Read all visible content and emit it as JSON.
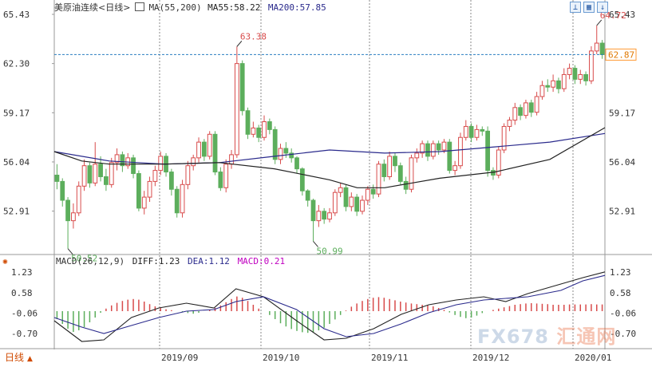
{
  "main_panel": {
    "title": "美原油连续<日线>",
    "ma_label": "MA(55,200)",
    "ma55_text": "MA55:58.22",
    "ma200_text": "MA200:57.85",
    "current_price": "62.87",
    "annotations": {
      "high1": "63.38",
      "low1": "50.52",
      "low2": "50.99",
      "high2": "64.72"
    }
  },
  "macd_panel": {
    "label": "MACD(26,12,9)",
    "diff_text": "DIFF:1.23",
    "dea_text": "DEA:1.12",
    "macd_text": "MACD:0.21"
  },
  "bottom": {
    "tab_label": "日线",
    "watermark_a": "FX678",
    "watermark_b": "汇通网"
  },
  "colors": {
    "up": "#d84b4b",
    "down": "#5cae5c",
    "ma_blue": "#2a2a8c",
    "ma_black": "#222222",
    "grid": "#888888",
    "price_line": "#2a7fc0",
    "price_tag": "#ff9a33",
    "macd_pos": "#d84b4b",
    "macd_neg": "#5cae5c",
    "dea_line": "#2a2a8c"
  },
  "chart_data": [
    {
      "type": "candlestick",
      "y_ticks_left": [
        "65.43",
        "62.30",
        "59.17",
        "56.04",
        "52.91"
      ],
      "y_ticks_right": [
        "65.43",
        "62.87",
        "59.17",
        "56.04",
        "52.91"
      ],
      "x_labels": [
        "2019/09",
        "2019/10",
        "2019/11",
        "2019/12",
        "2020/01"
      ],
      "ylim": [
        50.2,
        65.43
      ],
      "last_price": 62.87,
      "candles": [
        [
          55.2,
          54.8,
          55.9,
          54.3
        ],
        [
          54.8,
          53.6,
          55.0,
          53.2
        ],
        [
          53.6,
          52.3,
          53.8,
          50.52
        ],
        [
          52.3,
          52.8,
          53.4,
          51.8
        ],
        [
          52.8,
          54.5,
          54.8,
          52.6
        ],
        [
          54.5,
          55.8,
          56.2,
          54.2
        ],
        [
          55.8,
          54.7,
          56.0,
          54.4
        ],
        [
          54.7,
          55.9,
          57.3,
          54.5
        ],
        [
          55.9,
          55.1,
          56.4,
          54.8
        ],
        [
          55.1,
          54.6,
          55.6,
          54.2
        ],
        [
          54.6,
          56.0,
          56.3,
          54.4
        ],
        [
          56.0,
          56.5,
          56.9,
          55.5
        ],
        [
          56.5,
          55.8,
          56.7,
          55.4
        ],
        [
          55.8,
          56.3,
          56.6,
          55.6
        ],
        [
          56.3,
          55.3,
          56.5,
          55.0
        ],
        [
          55.3,
          53.1,
          55.5,
          52.9
        ],
        [
          53.1,
          53.8,
          54.2,
          52.7
        ],
        [
          53.8,
          54.8,
          55.1,
          53.5
        ],
        [
          54.8,
          55.5,
          55.8,
          54.5
        ],
        [
          55.5,
          56.4,
          56.7,
          55.2
        ],
        [
          56.4,
          55.4,
          56.6,
          55.1
        ],
        [
          55.4,
          54.3,
          55.6,
          53.9
        ],
        [
          54.3,
          52.8,
          54.5,
          52.5
        ],
        [
          52.8,
          54.6,
          54.9,
          52.5
        ],
        [
          54.6,
          55.8,
          56.1,
          54.3
        ],
        [
          55.8,
          56.3,
          56.5,
          55.5
        ],
        [
          56.3,
          57.3,
          57.6,
          56.0
        ],
        [
          57.3,
          56.4,
          57.5,
          56.1
        ],
        [
          56.4,
          57.8,
          58.0,
          56.2
        ],
        [
          57.8,
          55.4,
          58.0,
          55.2
        ],
        [
          55.4,
          54.4,
          55.7,
          54.2
        ],
        [
          54.4,
          55.9,
          56.2,
          54.1
        ],
        [
          55.9,
          56.5,
          56.8,
          55.6
        ],
        [
          56.5,
          62.3,
          63.38,
          56.3
        ],
        [
          62.3,
          59.3,
          62.5,
          59.0
        ],
        [
          59.3,
          57.8,
          59.5,
          57.5
        ],
        [
          57.8,
          58.2,
          58.6,
          57.6
        ],
        [
          58.2,
          57.6,
          58.4,
          57.3
        ],
        [
          57.6,
          58.6,
          59.0,
          57.4
        ],
        [
          58.6,
          58.1,
          58.8,
          57.8
        ],
        [
          58.1,
          56.2,
          58.3,
          55.9
        ],
        [
          56.2,
          56.9,
          57.2,
          55.9
        ],
        [
          56.9,
          56.6,
          57.3,
          56.3
        ],
        [
          56.6,
          56.3,
          56.9,
          56.0
        ],
        [
          56.3,
          55.6,
          56.4,
          55.3
        ],
        [
          55.6,
          54.2,
          55.7,
          53.9
        ],
        [
          54.2,
          53.6,
          54.3,
          53.2
        ],
        [
          53.6,
          52.3,
          53.7,
          50.99
        ],
        [
          52.3,
          52.9,
          53.3,
          51.9
        ],
        [
          52.9,
          52.4,
          53.1,
          52.1
        ],
        [
          52.4,
          52.8,
          53.1,
          52.2
        ],
        [
          52.8,
          54.1,
          54.3,
          52.6
        ],
        [
          54.1,
          54.4,
          54.7,
          53.8
        ],
        [
          54.4,
          53.2,
          54.6,
          52.9
        ],
        [
          53.2,
          53.8,
          54.1,
          52.9
        ],
        [
          53.8,
          52.9,
          54.0,
          52.6
        ],
        [
          52.9,
          53.6,
          53.9,
          52.7
        ],
        [
          53.6,
          54.3,
          54.5,
          53.3
        ],
        [
          54.3,
          54.0,
          54.6,
          53.7
        ],
        [
          54.0,
          55.9,
          56.1,
          53.8
        ],
        [
          55.9,
          55.1,
          56.2,
          54.8
        ],
        [
          55.1,
          56.4,
          56.7,
          54.9
        ],
        [
          56.4,
          55.8,
          56.6,
          55.4
        ],
        [
          55.8,
          54.8,
          56.0,
          54.6
        ],
        [
          54.8,
          54.3,
          55.1,
          54.0
        ],
        [
          54.3,
          56.3,
          56.5,
          54.1
        ],
        [
          56.3,
          56.6,
          56.9,
          56.0
        ],
        [
          56.6,
          57.2,
          57.4,
          56.3
        ],
        [
          57.2,
          56.4,
          57.4,
          56.1
        ],
        [
          56.4,
          57.2,
          57.4,
          56.2
        ],
        [
          57.2,
          56.8,
          57.4,
          56.5
        ],
        [
          56.8,
          57.3,
          57.5,
          56.6
        ],
        [
          57.3,
          55.5,
          57.5,
          55.3
        ],
        [
          55.5,
          55.8,
          56.1,
          55.2
        ],
        [
          55.8,
          57.6,
          57.9,
          55.6
        ],
        [
          57.6,
          58.3,
          58.7,
          57.4
        ],
        [
          58.3,
          57.6,
          58.5,
          57.3
        ],
        [
          57.6,
          58.1,
          58.4,
          57.4
        ],
        [
          58.1,
          58.0,
          58.3,
          57.7
        ],
        [
          58.0,
          55.5,
          58.3,
          55.1
        ],
        [
          55.5,
          55.2,
          55.7,
          54.9
        ],
        [
          55.2,
          56.8,
          57.0,
          55.0
        ],
        [
          56.8,
          58.3,
          58.5,
          56.6
        ],
        [
          58.3,
          58.7,
          58.9,
          58.0
        ],
        [
          58.7,
          59.5,
          59.8,
          58.4
        ],
        [
          59.5,
          59.0,
          59.7,
          58.7
        ],
        [
          59.0,
          59.8,
          60.0,
          58.8
        ],
        [
          59.8,
          59.2,
          60.0,
          58.9
        ],
        [
          59.2,
          60.2,
          60.5,
          59.0
        ],
        [
          60.2,
          60.9,
          61.2,
          60.0
        ],
        [
          60.9,
          60.8,
          61.3,
          60.5
        ],
        [
          60.8,
          61.2,
          61.6,
          60.5
        ],
        [
          61.2,
          60.7,
          61.4,
          60.4
        ],
        [
          60.7,
          61.6,
          62.0,
          60.5
        ],
        [
          61.6,
          62.0,
          62.3,
          61.3
        ],
        [
          62.0,
          61.3,
          62.2,
          61.0
        ],
        [
          61.3,
          61.6,
          61.9,
          61.0
        ],
        [
          61.6,
          61.2,
          61.8,
          60.9
        ],
        [
          61.2,
          63.1,
          63.4,
          61.0
        ],
        [
          63.1,
          63.6,
          64.72,
          62.9
        ],
        [
          63.6,
          62.87,
          63.8,
          62.6
        ]
      ],
      "ma55": [
        [
          0,
          56.7
        ],
        [
          10,
          56.1
        ],
        [
          20,
          55.9
        ],
        [
          30,
          56.0
        ],
        [
          40,
          56.4
        ],
        [
          50,
          56.8
        ],
        [
          60,
          56.6
        ],
        [
          70,
          56.7
        ],
        [
          80,
          57.0
        ],
        [
          90,
          57.3
        ],
        [
          100,
          57.85
        ]
      ],
      "ma200": [
        [
          0,
          56.7
        ],
        [
          5,
          56.1
        ],
        [
          10,
          55.9
        ],
        [
          20,
          55.9
        ],
        [
          30,
          56.0
        ],
        [
          40,
          55.6
        ],
        [
          50,
          54.9
        ],
        [
          55,
          54.4
        ],
        [
          60,
          54.4
        ],
        [
          70,
          55.0
        ],
        [
          80,
          55.4
        ],
        [
          90,
          56.2
        ],
        [
          100,
          58.22
        ]
      ]
    },
    {
      "type": "macd",
      "y_ticks": [
        "1.23",
        "0.58",
        "-0.06",
        "-0.70"
      ],
      "ylim": [
        -1.05,
        1.5
      ],
      "diff": [
        [
          0,
          -0.3
        ],
        [
          5,
          -0.95
        ],
        [
          9,
          -0.9
        ],
        [
          14,
          -0.2
        ],
        [
          19,
          0.1
        ],
        [
          24,
          0.25
        ],
        [
          29,
          0.1
        ],
        [
          33,
          0.7
        ],
        [
          38,
          0.45
        ],
        [
          44,
          -0.3
        ],
        [
          49,
          -0.9
        ],
        [
          53,
          -0.85
        ],
        [
          58,
          -0.55
        ],
        [
          63,
          -0.1
        ],
        [
          68,
          0.2
        ],
        [
          73,
          0.35
        ],
        [
          78,
          0.45
        ],
        [
          82,
          0.3
        ],
        [
          86,
          0.55
        ],
        [
          92,
          0.85
        ],
        [
          96,
          1.05
        ],
        [
          100,
          1.23
        ]
      ],
      "dea": [
        [
          0,
          -0.2
        ],
        [
          5,
          -0.5
        ],
        [
          9,
          -0.7
        ],
        [
          14,
          -0.45
        ],
        [
          19,
          -0.2
        ],
        [
          24,
          0.0
        ],
        [
          29,
          0.05
        ],
        [
          33,
          0.3
        ],
        [
          38,
          0.45
        ],
        [
          44,
          0.05
        ],
        [
          49,
          -0.55
        ],
        [
          53,
          -0.8
        ],
        [
          58,
          -0.7
        ],
        [
          63,
          -0.4
        ],
        [
          68,
          -0.05
        ],
        [
          73,
          0.2
        ],
        [
          78,
          0.35
        ],
        [
          82,
          0.4
        ],
        [
          86,
          0.45
        ],
        [
          92,
          0.65
        ],
        [
          96,
          0.95
        ],
        [
          100,
          1.12
        ]
      ],
      "hist": [
        -0.25,
        -0.4,
        -0.55,
        -0.65,
        -0.6,
        -0.5,
        -0.35,
        -0.2,
        -0.05,
        0.08,
        0.18,
        0.26,
        0.32,
        0.36,
        0.38,
        0.36,
        0.3,
        0.22,
        0.15,
        0.1,
        0.06,
        0.03,
        0.0,
        -0.03,
        -0.06,
        -0.08,
        -0.05,
        0.0,
        0.05,
        0.1,
        0.18,
        0.28,
        0.38,
        0.46,
        0.42,
        0.32,
        0.2,
        0.08,
        0.0,
        -0.12,
        -0.25,
        -0.38,
        -0.48,
        -0.56,
        -0.62,
        -0.66,
        -0.68,
        -0.66,
        -0.6,
        -0.52,
        -0.4,
        -0.26,
        -0.12,
        0.02,
        0.14,
        0.24,
        0.32,
        0.38,
        0.42,
        0.44,
        0.42,
        0.38,
        0.34,
        0.3,
        0.27,
        0.24,
        0.22,
        0.2,
        0.18,
        0.15,
        0.1,
        0.04,
        -0.04,
        -0.12,
        -0.18,
        -0.22,
        -0.2,
        -0.14,
        -0.06,
        0.0,
        0.04,
        0.08,
        0.12,
        0.16,
        0.2,
        0.22,
        0.24,
        0.25,
        0.24,
        0.23,
        0.22,
        0.2,
        0.2,
        0.2,
        0.21,
        0.21,
        0.21,
        0.21,
        0.22,
        0.21,
        0.21
      ]
    }
  ]
}
